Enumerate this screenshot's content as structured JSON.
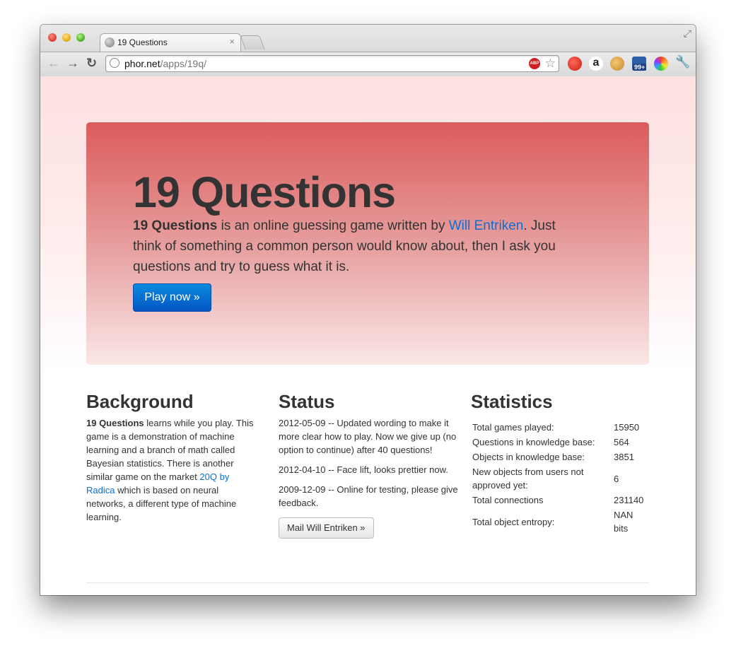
{
  "browser": {
    "tab_title": "19 Questions",
    "tab_close": "×",
    "url_host": "phor.net",
    "url_path": "/apps/19q/",
    "back_glyph": "←",
    "forward_glyph": "→",
    "reload_glyph": "↻",
    "adblock_label": "ABP",
    "bookmark_star": "☆",
    "amazon_glyph": "a",
    "badge_count": "99+",
    "wrench_glyph": "🔧",
    "fullscreen_glyph": "⤢"
  },
  "hero": {
    "title": "19 Questions",
    "lead_strong": "19 Questions",
    "lead_text_1": " is an online guessing game written by ",
    "lead_link": "Will Entriken",
    "lead_text_2": ". Just think of something a common person would know about, then I ask you questions and try to guess what it is.",
    "play_button": "Play now »"
  },
  "background": {
    "heading": "Background",
    "strong": "19 Questions",
    "text_1": " learns while you play. This game is a demonstration of machine learning and a branch of math called Bayesian statistics. There is another similar game on the market ",
    "link": "20Q by Radica",
    "text_2": " which is based on neural networks, a different type of machine learning."
  },
  "status": {
    "heading": "Status",
    "entries": [
      "2012-05-09 -- Updated wording to make it more clear how to play. Now we give up (no option to continue) after 40 questions!",
      "2012-04-10 -- Face lift, looks prettier now.",
      "2009-12-09 -- Online for testing, please give feedback."
    ],
    "mail_button": "Mail Will Entriken »"
  },
  "statistics": {
    "heading": "Statistics",
    "rows": [
      {
        "label": "Total games played:",
        "value": "15950"
      },
      {
        "label": "Questions in knowledge base:",
        "value": "564"
      },
      {
        "label": "Objects in knowledge base:",
        "value": "3851"
      },
      {
        "label": "New objects from users not approved yet:",
        "value": "6"
      },
      {
        "label": "Total connections",
        "value": "231140"
      },
      {
        "label": "Total object entropy:",
        "value": "NAN bits"
      }
    ]
  }
}
